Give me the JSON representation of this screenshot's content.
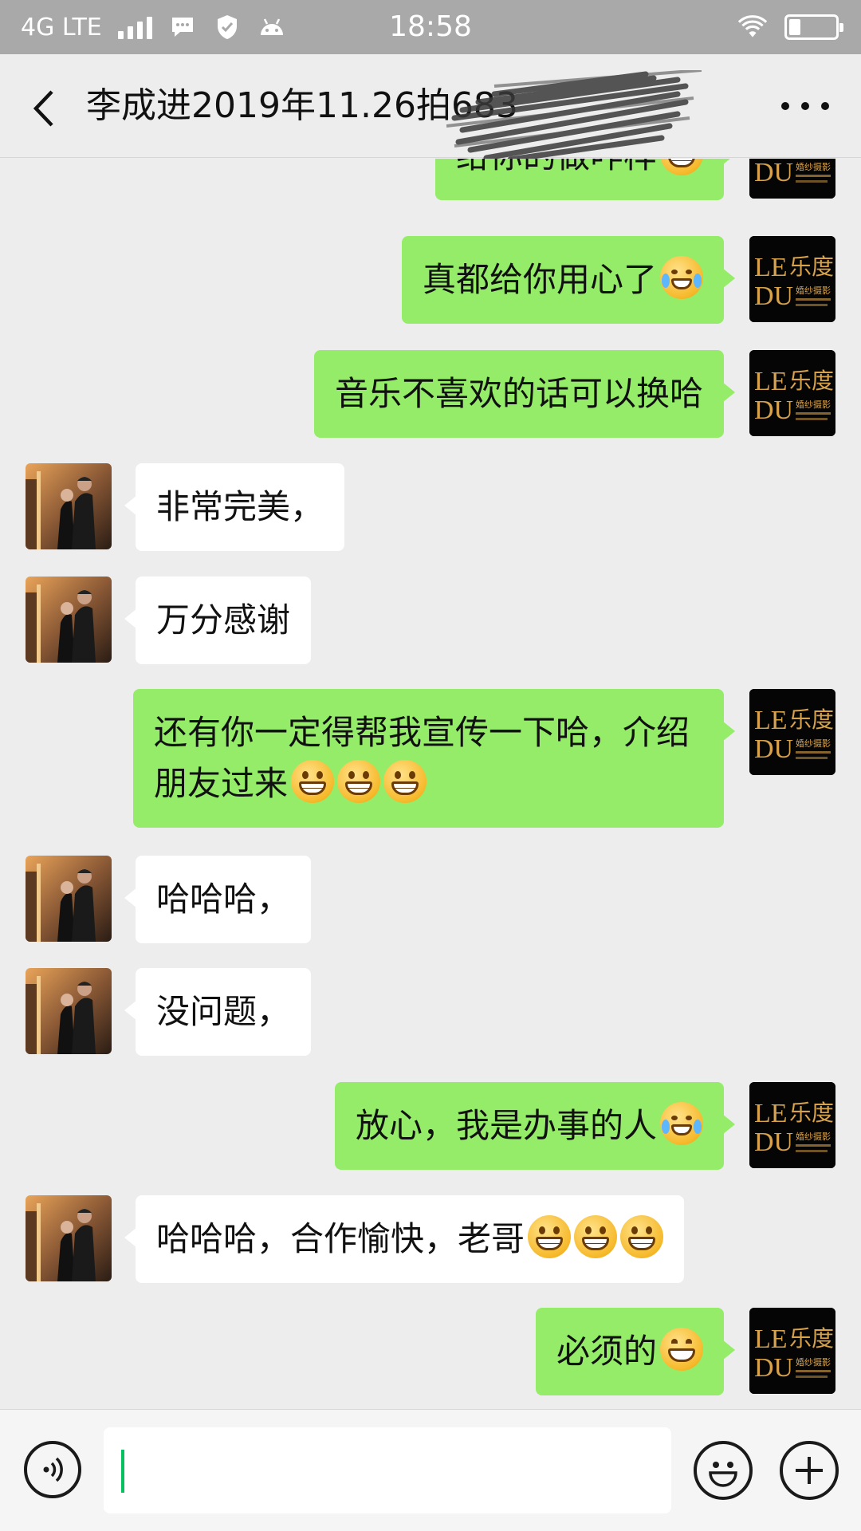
{
  "status_bar": {
    "network": "4G LTE",
    "time": "18:58"
  },
  "header": {
    "title": "李成进2019年11.26拍683"
  },
  "avatar_logo": {
    "text_le": "LE",
    "text_cn": "乐度",
    "text_du": "DU",
    "text_small": "婚纱摄影"
  },
  "messages": [
    {
      "sender": "me",
      "text": "给你的做咋样",
      "emojis": [
        "grin"
      ]
    },
    {
      "sender": "me",
      "text": "真都给你用心了",
      "emojis": [
        "tears-of-joy"
      ]
    },
    {
      "sender": "me",
      "text": "音乐不喜欢的话可以换哈",
      "emojis": []
    },
    {
      "sender": "contact",
      "text": "非常完美，",
      "emojis": []
    },
    {
      "sender": "contact",
      "text": "万分感谢",
      "emojis": []
    },
    {
      "sender": "me",
      "text": "还有你一定得帮我宣传一下哈，介绍朋友过来",
      "emojis": [
        "grin",
        "grin",
        "grin"
      ]
    },
    {
      "sender": "contact",
      "text": "哈哈哈，",
      "emojis": []
    },
    {
      "sender": "contact",
      "text": "没问题，",
      "emojis": []
    },
    {
      "sender": "me",
      "text": "放心，我是办事的人",
      "emojis": [
        "tears-of-joy"
      ]
    },
    {
      "sender": "contact",
      "text": "哈哈哈，合作愉快，老哥",
      "emojis": [
        "grin",
        "grin",
        "grin"
      ]
    },
    {
      "sender": "me",
      "text": "必须的",
      "emojis": [
        "smile"
      ]
    }
  ],
  "input": {
    "value": ""
  },
  "colors": {
    "my_bubble": "#95ec69",
    "contact_bubble": "#ffffff",
    "background": "#ededed",
    "caret": "#07c160"
  }
}
